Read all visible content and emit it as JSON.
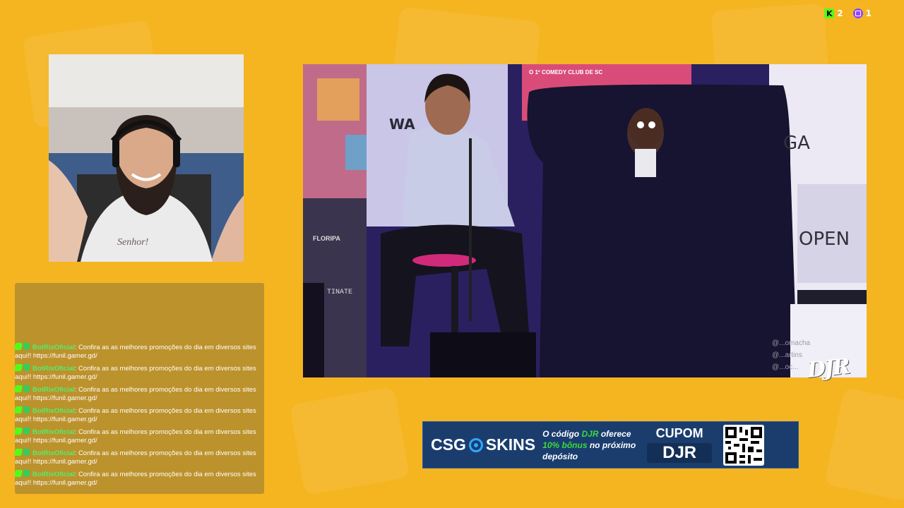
{
  "viewers": {
    "kick": {
      "icon": "kick-icon",
      "count": "2",
      "color": "#53fc18"
    },
    "twitch": {
      "icon": "twitch-icon",
      "count": "1",
      "color": "#9146ff"
    }
  },
  "webcam": {
    "shirt_text": "Senhor!"
  },
  "main_video": {
    "banner_top": "O 1º COMEDY CLUB DE SC",
    "wall_text_left": "WA",
    "wall_text_right": "GA",
    "wall_text_open": "OPEN",
    "stand_logo": "FLORIPA",
    "stand_plate": "TINATE",
    "credits": [
      "@...omacha",
      "@...artins",
      "@...oc..."
    ]
  },
  "chat": {
    "messages": [
      {
        "user": "BotRixOficial",
        "text": "Confira as as melhores promoções do dia em diversos sites aqui!! https://funil.gamer.gd/"
      },
      {
        "user": "BotRixOficial",
        "text": "Confira as as melhores promoções do dia em diversos sites aqui!! https://funil.gamer.gd/"
      },
      {
        "user": "BotRixOficial",
        "text": "Confira as as melhores promoções do dia em diversos sites aqui!! https://funil.gamer.gd/"
      },
      {
        "user": "BotRixOficial",
        "text": "Confira as as melhores promoções do dia em diversos sites aqui!! https://funil.gamer.gd/"
      },
      {
        "user": "BotRixOficial",
        "text": "Confira as as melhores promoções do dia em diversos sites aqui!! https://funil.gamer.gd/"
      },
      {
        "user": "BotRixOficial",
        "text": "Confira as as melhores promoções do dia em diversos sites aqui!! https://funil.gamer.gd/"
      },
      {
        "user": "BotRixOficial",
        "text": "Confira as as melhores promoções do dia em diversos sites aqui!! https://funil.gamer.gd/"
      }
    ]
  },
  "overlay_logo": "DJR",
  "sponsor": {
    "brand_left": "CSG",
    "brand_right": "SKINS",
    "line1_pre": "O código ",
    "line1_code": "DJR",
    "line1_post": " oferece",
    "line2_bonus": "10% bônus",
    "line2_post": " no próximo",
    "line3": "depósito",
    "coupon_label": "CUPOM",
    "coupon_code": "DJR",
    "accent_color": "#3adb3a"
  }
}
